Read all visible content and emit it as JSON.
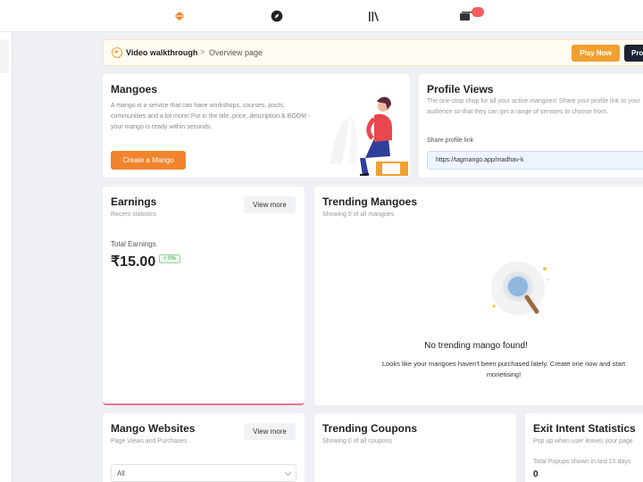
{
  "topnav": {
    "items": [
      {
        "icon": "diamond-icon",
        "color": "#f0842c"
      },
      {
        "icon": "compass-icon"
      },
      {
        "icon": "library-icon"
      },
      {
        "icon": "messages-icon"
      }
    ],
    "badge_color": "#f25d5d"
  },
  "breadcrumb": {
    "link": "Video walkthrough",
    "separator": ">",
    "current": "Overview page",
    "play_button": "Play Now",
    "dark_button": "Pro"
  },
  "mangoes": {
    "title": "Mangoes",
    "description": "A mango is a service that can have workshops, courses, posts, communities and a lot more! Put in the title, price, description & BOOM - your mango is ready within seconds.",
    "create_button": "Create a Mango"
  },
  "profile_views": {
    "title": "Profile Views",
    "description": "The one-stop shop for all your active mangoes! Share your profile link to your audience so that they can get a range of services to choose from.",
    "share_label": "Share profile link",
    "link": "https://tagmango.app/madhav-k"
  },
  "earnings": {
    "title": "Earnings",
    "subtitle": "Recent statistics",
    "view_more": "View more",
    "total_label": "Total Earnings",
    "total_value": "₹15.00",
    "growth": "+ 0%"
  },
  "trending_mangoes": {
    "title": "Trending Mangoes",
    "subtitle": "Showing 0 of all mangoes",
    "empty_title": "No trending mango found!",
    "empty_desc": "Looks like your mangoes haven't been purchased lately. Create one now and start monetising!"
  },
  "mango_websites": {
    "title": "Mango Websites",
    "subtitle": "Page Views and Purchases",
    "view_more": "View more",
    "select_value": "All"
  },
  "trending_coupons": {
    "title": "Trending Coupons",
    "subtitle": "Showing 0 of all coupons"
  },
  "exit_intent": {
    "title": "Exit Intent Statistics",
    "subtitle": "Pop up when user leaves your page",
    "metric_label": "Total Popups shown in last 15 days",
    "metric_value": "0"
  },
  "colors": {
    "accent": "#f0842c",
    "play": "#f0a12f",
    "dark": "#1b2430",
    "earnings_underline": "#f27591"
  }
}
